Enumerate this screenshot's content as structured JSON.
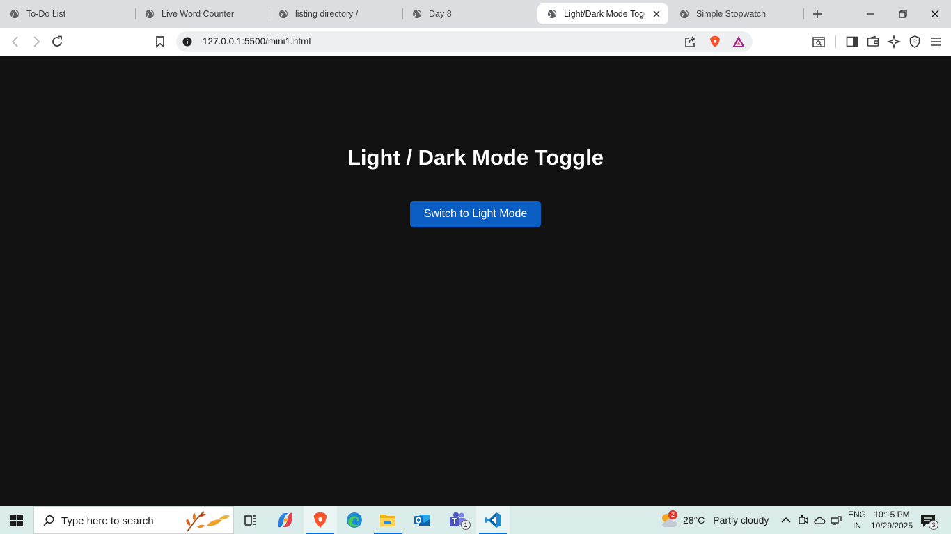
{
  "browser": {
    "tabs": [
      {
        "title": "To-Do List",
        "active": false
      },
      {
        "title": "Live Word Counter",
        "active": false
      },
      {
        "title": "listing directory /",
        "active": false
      },
      {
        "title": "Day 8",
        "active": false
      },
      {
        "title": "Light/Dark Mode Togg",
        "active": true
      },
      {
        "title": "Simple Stopwatch",
        "active": false
      }
    ],
    "url": "127.0.0.1:5500/mini1.html"
  },
  "page": {
    "heading": "Light / Dark Mode Toggle",
    "toggle_label": "Switch to Light Mode",
    "background_color": "#121212",
    "button_color": "#0a5dc2"
  },
  "taskbar": {
    "search_placeholder": "Type here to search",
    "apps": [
      "task-view",
      "copilot",
      "brave",
      "edge",
      "file-explorer",
      "outlook",
      "teams",
      "vs-code"
    ],
    "teams_badge": "1",
    "weather": {
      "badge": "2",
      "temp": "28°C",
      "condition": "Partly cloudy"
    },
    "lang_line1": "ENG",
    "lang_line2": "IN",
    "time": "10:15 PM",
    "date": "10/29/2025",
    "notifications": "3"
  }
}
